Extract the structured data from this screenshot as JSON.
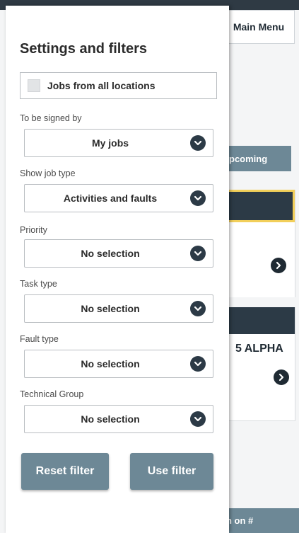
{
  "background": {
    "main_menu": "Main Menu",
    "upcoming_tab": "pcoming",
    "card2_title": "5 ALPHA",
    "footer_text": "n on #"
  },
  "panel": {
    "title": "Settings and filters",
    "all_locations": {
      "label": "Jobs from all locations",
      "checked": false
    },
    "fields": [
      {
        "label": "To be signed by",
        "value": "My jobs"
      },
      {
        "label": "Show job type",
        "value": "Activities and faults"
      },
      {
        "label": "Priority",
        "value": "No selection"
      },
      {
        "label": "Task type",
        "value": "No selection"
      },
      {
        "label": "Fault type",
        "value": "No selection"
      },
      {
        "label": "Technical Group",
        "value": "No selection"
      }
    ],
    "reset_button": "Reset filter",
    "use_button": "Use filter"
  },
  "icons": {
    "dropdown": "chevron-down-icon",
    "card": "chevron-right-icon"
  },
  "colors": {
    "accent": "#6d8896",
    "dark": "#2c3a46",
    "highlight": "#f2cf5a"
  }
}
